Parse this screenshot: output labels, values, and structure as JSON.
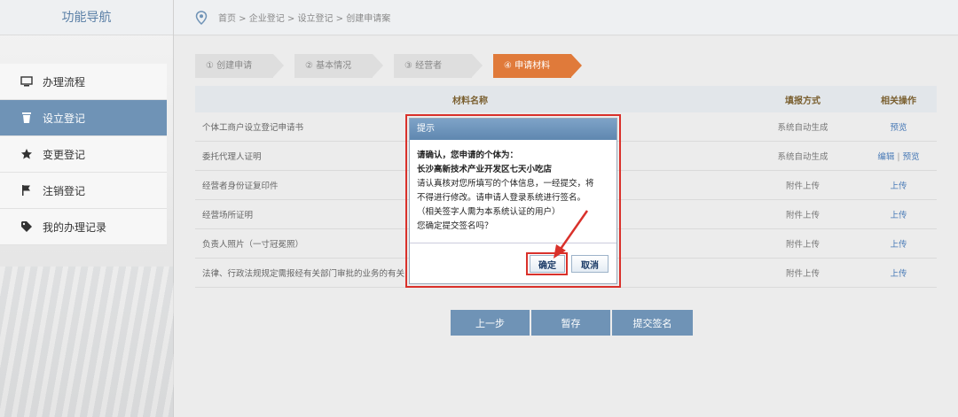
{
  "sidebar": {
    "title": "功能导航",
    "items": [
      {
        "label": "办理流程",
        "icon": "monitor-icon"
      },
      {
        "label": "设立登记",
        "icon": "trash-icon"
      },
      {
        "label": "变更登记",
        "icon": "star-icon"
      },
      {
        "label": "注销登记",
        "icon": "flag-icon"
      },
      {
        "label": "我的办理记录",
        "icon": "tag-icon"
      }
    ]
  },
  "header": {
    "breadcrumb": "首页 > 企业登记 > 设立登记 > 创建申请案"
  },
  "steps": [
    {
      "label": "① 创建申请"
    },
    {
      "label": "② 基本情况"
    },
    {
      "label": "③ 经营者"
    },
    {
      "label": "④ 申请材料"
    }
  ],
  "table": {
    "headers": {
      "name": "材料名称",
      "method": "填报方式",
      "ops": "相关操作"
    },
    "rows": [
      {
        "name": "个体工商户设立登记申请书",
        "method": "系统自动生成",
        "op1": "预览",
        "op2": ""
      },
      {
        "name": "委托代理人证明",
        "method": "系统自动生成",
        "op1": "编辑",
        "op2": "预览"
      },
      {
        "name": "经营者身份证复印件",
        "method": "附件上传",
        "op1": "上传",
        "op2": ""
      },
      {
        "name": "经营场所证明",
        "method": "附件上传",
        "op1": "上传",
        "op2": ""
      },
      {
        "name": "负责人照片（一寸冠冕照）",
        "method": "附件上传",
        "op1": "上传",
        "op2": ""
      },
      {
        "name": "法律、行政法规规定需报经有关部门审批的业务的有关",
        "method": "附件上传",
        "op1": "上传",
        "op2": ""
      }
    ]
  },
  "buttons": {
    "prev": "上一步",
    "save": "暂存",
    "submit": "提交签名"
  },
  "modal": {
    "title": "提示",
    "line1": "请确认，您申请的个体为：",
    "line2": "长沙高新技术产业开发区七天小吃店",
    "line3": "请认真核对您所填写的个体信息，一经提交，将",
    "line4": "不得进行修改。请申请人登录系统进行签名。",
    "line5": "（相关签字人需为本系统认证的用户）",
    "line6": "您确定提交签名吗？",
    "ok": "确定",
    "cancel": "取消"
  },
  "colors": {
    "accent": "#6f93b6",
    "active_step": "#e07a3a",
    "highlight": "#d9312b"
  }
}
